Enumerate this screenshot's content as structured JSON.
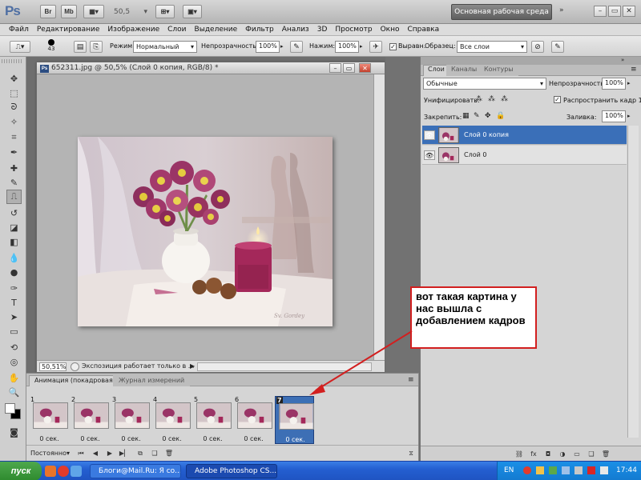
{
  "appbar": {
    "logo": "Ps",
    "btn_br": "Br",
    "btn_mb": "Mb",
    "zoom": "50,5",
    "workspace": "Основная рабочая среда"
  },
  "menu": [
    "Файл",
    "Редактирование",
    "Изображение",
    "Слои",
    "Выделение",
    "Фильтр",
    "Анализ",
    "3D",
    "Просмотр",
    "Окно",
    "Справка"
  ],
  "options": {
    "brush_size": "43",
    "mode_label": "Режим:",
    "mode_value": "Нормальный",
    "opacity_label": "Непрозрачность:",
    "opacity_value": "100%",
    "flow_label": "Нажим:",
    "flow_value": "100%",
    "aligned_label": "Выравн.",
    "sample_label": "Образец:",
    "sample_value": "Все слои"
  },
  "document": {
    "title": "652311.jpg @ 50,5% (Слой 0 копия, RGB/8) *",
    "zoom": "50,51%",
    "status": "Экспозиция работает только в ..."
  },
  "animation": {
    "tab_active": "Анимация (покадровая)",
    "tab_inactive": "Журнал измерений",
    "frames": [
      {
        "num": "1",
        "delay": "0 сек."
      },
      {
        "num": "2",
        "delay": "0 сек."
      },
      {
        "num": "3",
        "delay": "0 сек."
      },
      {
        "num": "4",
        "delay": "0 сек."
      },
      {
        "num": "5",
        "delay": "0 сек."
      },
      {
        "num": "6",
        "delay": "0 сек."
      },
      {
        "num": "7",
        "delay": "0 сек."
      }
    ],
    "selected_frame": 7,
    "loop": "Постоянно"
  },
  "layers_panel": {
    "tabs": [
      "Слои",
      "Каналы",
      "Контуры"
    ],
    "blend_mode": "Обычные",
    "opacity_label": "Непрозрачность:",
    "opacity_value": "100%",
    "unify_label": "Унифицировать:",
    "propagate_label": "Распространить кадр 1",
    "lock_label": "Закрепить:",
    "fill_label": "Заливка:",
    "fill_value": "100%",
    "layers": [
      {
        "name": "Слой 0 копия",
        "selected": true
      },
      {
        "name": "Слой 0",
        "selected": false
      }
    ]
  },
  "callout": {
    "text": "вот такая картина у нас вышла с добавлением кадров",
    "color": "#d21f1f"
  },
  "taskbar": {
    "start": "пуск",
    "tasks": [
      "Блоги@Mail.Ru: Я со...",
      "Adobe Photoshop CS..."
    ],
    "lang": "EN",
    "clock": "17:44"
  }
}
